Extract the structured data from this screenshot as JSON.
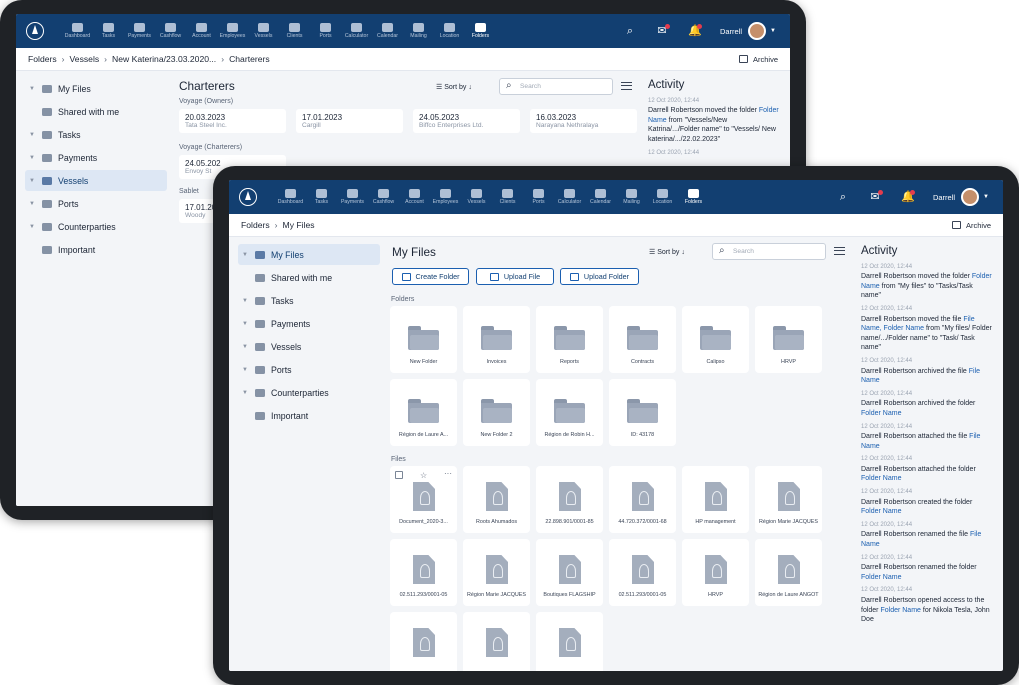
{
  "nav": {
    "items": [
      "Dashboard",
      "Tasks",
      "Payments",
      "Cashflow",
      "Account",
      "Employees",
      "Vessels",
      "Clients",
      "Ports",
      "Calculator",
      "Calendar",
      "Mailing",
      "Location",
      "Folders"
    ],
    "user": "Darrell"
  },
  "back": {
    "breadcrumb": [
      "Folders",
      "Vessels",
      "New Katerina/23.03.2020...",
      "Charterers"
    ],
    "archive": "Archive",
    "sidebar": [
      "My Files",
      "Shared with me",
      "Tasks",
      "Payments",
      "Vessels",
      "Ports",
      "Counterparties",
      "Important"
    ],
    "title": "Charterers",
    "sort": "Sort by",
    "search_placeholder": "Search",
    "groups": [
      {
        "label": "Voyage (Owners)",
        "cards": [
          {
            "date": "20.03.2023",
            "name": "Tata Steel Inc."
          },
          {
            "date": "17.01.2023",
            "name": "Cargill"
          },
          {
            "date": "24.05.2023",
            "name": "Biffco Enterprises Ltd."
          },
          {
            "date": "16.03.2023",
            "name": "Narayana Nethralaya"
          }
        ]
      },
      {
        "label": "Voyage (Charterers)",
        "cards": [
          {
            "date": "24.05.202",
            "name": "Envoy St"
          }
        ]
      },
      {
        "label": "Sablet",
        "cards": [
          {
            "date": "17.01.20",
            "name": "Woody"
          }
        ]
      }
    ],
    "activity": {
      "title": "Activity",
      "ts": "12 Oct 2020, 12:44",
      "pre": "Darrell Robertson moved the folder ",
      "link": "Folder Name",
      "post": " from \"Vessels/New Katrina/.../Folder name\" to \"Vessels/ New katerina/.../22.02.2023\"",
      "ts2": "12 Oct 2020, 12:44"
    }
  },
  "front": {
    "breadcrumb": [
      "Folders",
      "My Files"
    ],
    "archive": "Archive",
    "sidebar": [
      "My Files",
      "Shared with me",
      "Tasks",
      "Payments",
      "Vessels",
      "Ports",
      "Counterparties",
      "Important"
    ],
    "title": "My Files",
    "sort": "Sort by",
    "search_placeholder": "Search",
    "buttons": [
      "Create Folder",
      "Upload File",
      "Upload Folder"
    ],
    "folders_label": "Folders",
    "folders": [
      "New Folder",
      "Invoices",
      "Reports",
      "Contracts",
      "Calipso",
      "HRVP",
      "Région de Laure A...",
      "New Folder 2",
      "Région de Robin H...",
      "ID: 43178"
    ],
    "files_label": "Files",
    "files": [
      "Document_2020-3...",
      "Roots Ahumados",
      "22.898.901/0001-85",
      "44.720.372/0001-68",
      "HP management",
      "Région Marie JACQUES",
      "02.511.293/0001-05",
      "Région Marie JACQUES",
      "Boutiques FLAGSHIP",
      "02.511.293/0001-05",
      "HRVP",
      "Région de Laure ANGOT",
      "",
      "",
      ""
    ],
    "activity": {
      "title": "Activity",
      "entries": [
        {
          "ts": "12 Oct 2020, 12:44",
          "parts": [
            "Darrell Robertson moved the folder ",
            "Folder Name",
            " from \"My files\" to \"Tasks/Task name\""
          ]
        },
        {
          "ts": "12 Oct 2020, 12:44",
          "parts": [
            "Darrell Robertson moved the file ",
            "File Name, Folder Name",
            " from \"My files/ Folder name/.../Folder name\" to \"Task/ Task name\""
          ]
        },
        {
          "ts": "12 Oct 2020, 12:44",
          "parts": [
            "Darrell Robertson archived the file ",
            "File Name",
            ""
          ]
        },
        {
          "ts": "12 Oct 2020, 12:44",
          "parts": [
            "Darrell Robertson archived the folder ",
            "Folder Name",
            ""
          ]
        },
        {
          "ts": "12 Oct 2020, 12:44",
          "parts": [
            "Darrell Robertson attached the file ",
            "File Name",
            ""
          ]
        },
        {
          "ts": "12 Oct 2020, 12:44",
          "parts": [
            "Darrell Robertson attached the folder ",
            "Folder Name",
            ""
          ]
        },
        {
          "ts": "12 Oct 2020, 12:44",
          "parts": [
            "Darrell Robertson created the folder ",
            "Folder Name",
            ""
          ]
        },
        {
          "ts": "12 Oct 2020, 12:44",
          "parts": [
            "Darrell Robertson renamed the file ",
            "File Name",
            ""
          ]
        },
        {
          "ts": "12 Oct 2020, 12:44",
          "parts": [
            "Darrell Robertson renamed the folder ",
            "Folder Name",
            ""
          ]
        },
        {
          "ts": "12 Oct 2020, 12:44",
          "parts": [
            "Darrell Robertson opened access to the folder ",
            "Folder Name",
            " for Nikola Tesla, John Doe"
          ]
        }
      ]
    }
  }
}
